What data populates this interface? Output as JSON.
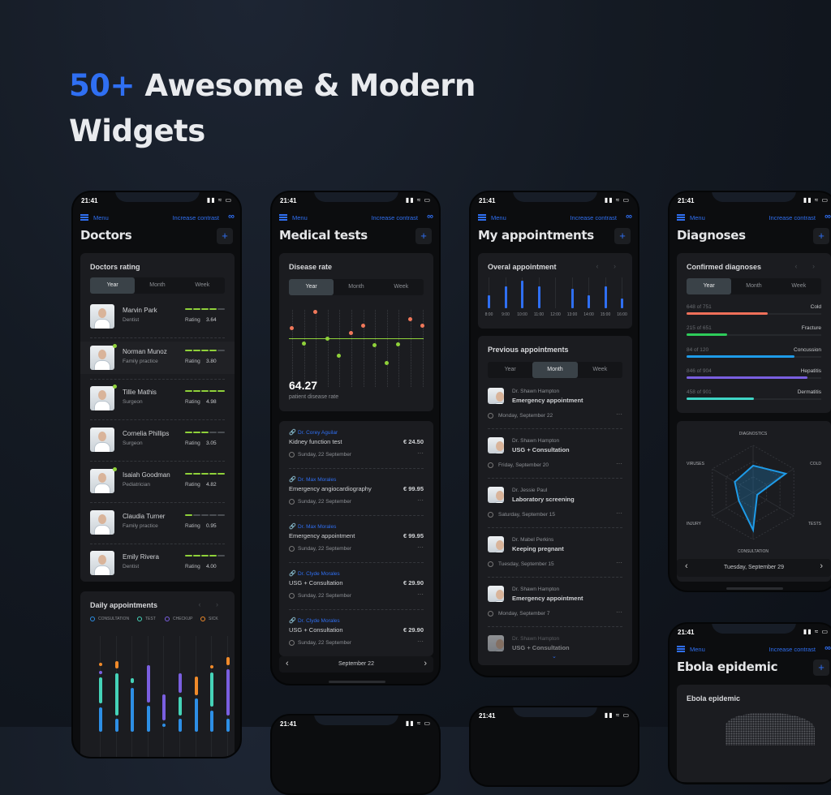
{
  "headline": {
    "accent": "50+",
    "rest": "Awesome & Modern",
    "line2": "Widgets"
  },
  "common": {
    "time": "21:41",
    "menu": "Menu",
    "contrast": "Increase contrast",
    "accent_color": "#2f6ff2"
  },
  "tabs": [
    "Year",
    "Month",
    "Week"
  ],
  "doctors": {
    "title": "Doctors",
    "rating_title": "Doctors rating",
    "active_tab": 0,
    "rating_label": "Rating",
    "list": [
      {
        "name": "Marvin Park",
        "specialty": "Dentist",
        "rating": "3.64",
        "online": false
      },
      {
        "name": "Norman Munoz",
        "specialty": "Family practice",
        "rating": "3.80",
        "online": true
      },
      {
        "name": "Tillie Mathis",
        "specialty": "Surgeon",
        "rating": "4.98",
        "online": true
      },
      {
        "name": "Cornelia Phillips",
        "specialty": "Surgeon",
        "rating": "3.05",
        "online": false
      },
      {
        "name": "Isaiah Goodman",
        "specialty": "Pediatrician",
        "rating": "4.82",
        "online": true
      },
      {
        "name": "Claudia Turner",
        "specialty": "Family practice",
        "rating": "0.95",
        "online": false
      },
      {
        "name": "Emily Rivera",
        "specialty": "Dentist",
        "rating": "4.00",
        "online": false
      }
    ],
    "daily": {
      "title": "Daily appointments",
      "legend": [
        {
          "label": "CONSULTATION",
          "color": "#2d8fe6"
        },
        {
          "label": "TEST",
          "color": "#45d3b8"
        },
        {
          "label": "CHECKUP",
          "color": "#7a5fe0"
        },
        {
          "label": "SICK",
          "color": "#f08a2a"
        }
      ],
      "columns": [
        [
          [
            "SICK",
            815,
            819
          ],
          [
            "CHECKUP",
            825,
            828
          ],
          [
            "TEST",
            833,
            865
          ],
          [
            "CONSULTATION",
            870,
            900
          ]
        ],
        [
          [
            "SICK",
            813,
            822
          ],
          [
            "TEST",
            828,
            880
          ],
          [
            "CONSULTATION",
            884,
            900
          ]
        ],
        [
          [
            "TEST",
            834,
            840
          ],
          [
            "CONSULTATION",
            846,
            900
          ]
        ],
        [
          [
            "CHECKUP",
            818,
            864
          ],
          [
            "CONSULTATION",
            868,
            900
          ]
        ],
        [
          [
            "CHECKUP",
            854,
            886
          ],
          [
            "CONSULTATION",
            890,
            893
          ]
        ],
        [
          [
            "CHECKUP",
            828,
            852
          ],
          [
            "TEST",
            857,
            880
          ],
          [
            "CONSULTATION",
            884,
            900
          ]
        ],
        [
          [
            "SICK",
            832,
            855
          ],
          [
            "CONSULTATION",
            859,
            900
          ]
        ],
        [
          [
            "SICK",
            818,
            822
          ],
          [
            "TEST",
            827,
            869
          ],
          [
            "CONSULTATION",
            874,
            900
          ]
        ],
        [
          [
            "SICK",
            808,
            818
          ],
          [
            "CHECKUP",
            823,
            880
          ],
          [
            "CONSULTATION",
            884,
            900
          ]
        ]
      ]
    }
  },
  "medical": {
    "title": "Medical tests",
    "disease": {
      "title": "Disease rate",
      "active_tab": 0,
      "value": "64.27",
      "caption": "patient disease rate",
      "above_color": "#f0785a",
      "below_color": "#8fd13a",
      "levels": [
        13,
        -6,
        33,
        0,
        -21,
        7,
        16,
        -8,
        -30,
        -7,
        24,
        16
      ]
    },
    "tests": [
      {
        "doctor": "Dr. Corey Aguilar",
        "test": "Kidney function test",
        "price": "€  24.50",
        "date": "Sunday, 22 September"
      },
      {
        "doctor": "Dr. Max Morales",
        "test": "Emergency angiocardiography",
        "price": "€  99.95",
        "date": "Sunday, 22 September"
      },
      {
        "doctor": "Dr. Max Morales",
        "test": "Emergency appointment",
        "price": "€  99.95",
        "date": "Sunday, 22 September"
      },
      {
        "doctor": "Dr. Clyde Morales",
        "test": "USG + Consultation",
        "price": "€  29.90",
        "date": "Sunday, 22 September"
      },
      {
        "doctor": "Dr. Clyde Morales",
        "test": "USG + Consultation",
        "price": "€  29.90",
        "date": "Sunday, 22 September"
      }
    ],
    "nav_date": "September 22"
  },
  "appointments": {
    "title": "My appointments",
    "overall": {
      "title": "Overal appointment",
      "times": [
        "8:00",
        "9:00",
        "10:00",
        "11:00",
        "12:00",
        "13:00",
        "14:00",
        "15:00",
        "16:00"
      ],
      "values": [
        16,
        27,
        34,
        27,
        0,
        24,
        16,
        27,
        12
      ]
    },
    "previous": {
      "title": "Previous appointments",
      "active_tab": 1,
      "list": [
        {
          "doctor": "Dr. Shawn Hampton",
          "title": "Emergency appointment",
          "date": "Monday, September 22"
        },
        {
          "doctor": "Dr. Shawn Hampton",
          "title": "USG + Consultation",
          "date": "Friday, September 20"
        },
        {
          "doctor": "Dr. Jessie Paul",
          "title": "Laboratory screening",
          "date": "Saturday, September 15"
        },
        {
          "doctor": "Dr. Mabel Perkins",
          "title": "Keeping pregnant",
          "date": "Tuesday, September 15"
        },
        {
          "doctor": "Dr. Shawn Hampton",
          "title": "Emergency appointment",
          "date": "Monday, September 7"
        },
        {
          "doctor": "Dr. Shawn Hampton",
          "title": "USG + Consultation",
          "date": ""
        }
      ]
    }
  },
  "diagnoses": {
    "title": "Diagnoses",
    "confirmed": {
      "title": "Confirmed diagnoses",
      "active_tab": 0,
      "list": [
        {
          "count": "648 of 751",
          "label": "Cold",
          "fill": 0.6,
          "color": "#f0705a"
        },
        {
          "count": "215 of 651",
          "label": "Fracture",
          "fill": 0.3,
          "color": "#2ecc5a"
        },
        {
          "count": "84 of 120",
          "label": "Concussion",
          "fill": 0.8,
          "color": "#1e9be8"
        },
        {
          "count": "846 of 904",
          "label": "Hepatitis",
          "fill": 0.9,
          "color": "#7a5fe0"
        },
        {
          "count": "458 of 901",
          "label": "Dermatitis",
          "fill": 0.5,
          "color": "#3fd6c6"
        }
      ]
    },
    "radar": {
      "axes": [
        "DIAGNOSTICS",
        "COLD",
        "TESTS",
        "CONSULTATION",
        "INJURY",
        "VIRUSES"
      ],
      "values": [
        0.57,
        0.8,
        0.1,
        0.8,
        0.35,
        0.45
      ],
      "color": "#1e9be8"
    },
    "date": "Tuesday, September 29"
  },
  "ebola": {
    "title": "Ebola epidemic",
    "card_title": "Ebola epidemic"
  }
}
